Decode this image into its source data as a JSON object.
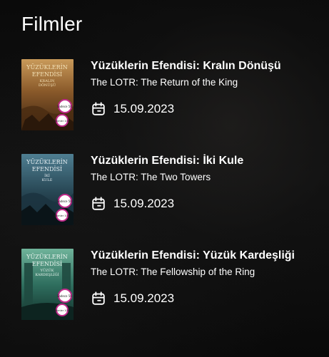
{
  "section": {
    "title": "Filmler"
  },
  "movies": [
    {
      "title": "Yüzüklerin Efendisi: Kralın Dönüşü",
      "subtitle": "The LOTR: The Return of the King",
      "date": "15.09.2023",
      "poster": {
        "line1": "YÜZÜKLERİN",
        "line2": "EFENDİSİ",
        "line3": "KRALIN",
        "line4": "DÖNÜŞÜ",
        "badge": "Sadece 50.",
        "badge2": "Ekimler 100."
      }
    },
    {
      "title": "Yüzüklerin Efendisi: İki Kule",
      "subtitle": "The LOTR: The Two Towers",
      "date": "15.09.2023",
      "poster": {
        "line1": "YÜZÜKLERİN",
        "line2": "EFENDİSİ",
        "line3": "İKİ",
        "line4": "KULE",
        "badge": "Sadece 50.",
        "badge2": "Ekimler 100."
      }
    },
    {
      "title": "Yüzüklerin Efendisi: Yüzük Kardeşliği",
      "subtitle": "The LOTR: The Fellowship of the Ring",
      "date": "15.09.2023",
      "poster": {
        "line1": "YÜZÜKLERİN",
        "line2": "EFENDİSİ",
        "line3": "YÜZÜK",
        "line4": "KARDEŞLİĞİ",
        "badge": "Sadece 50.",
        "badge2": "Ekimler 100."
      }
    }
  ],
  "colors": {
    "poster1": "#8a5a2a",
    "poster2": "#2a4a58",
    "poster3": "#2f6f5f",
    "badge_ring": "#c02a8a"
  },
  "icons": {
    "date": "calendar-icon"
  }
}
